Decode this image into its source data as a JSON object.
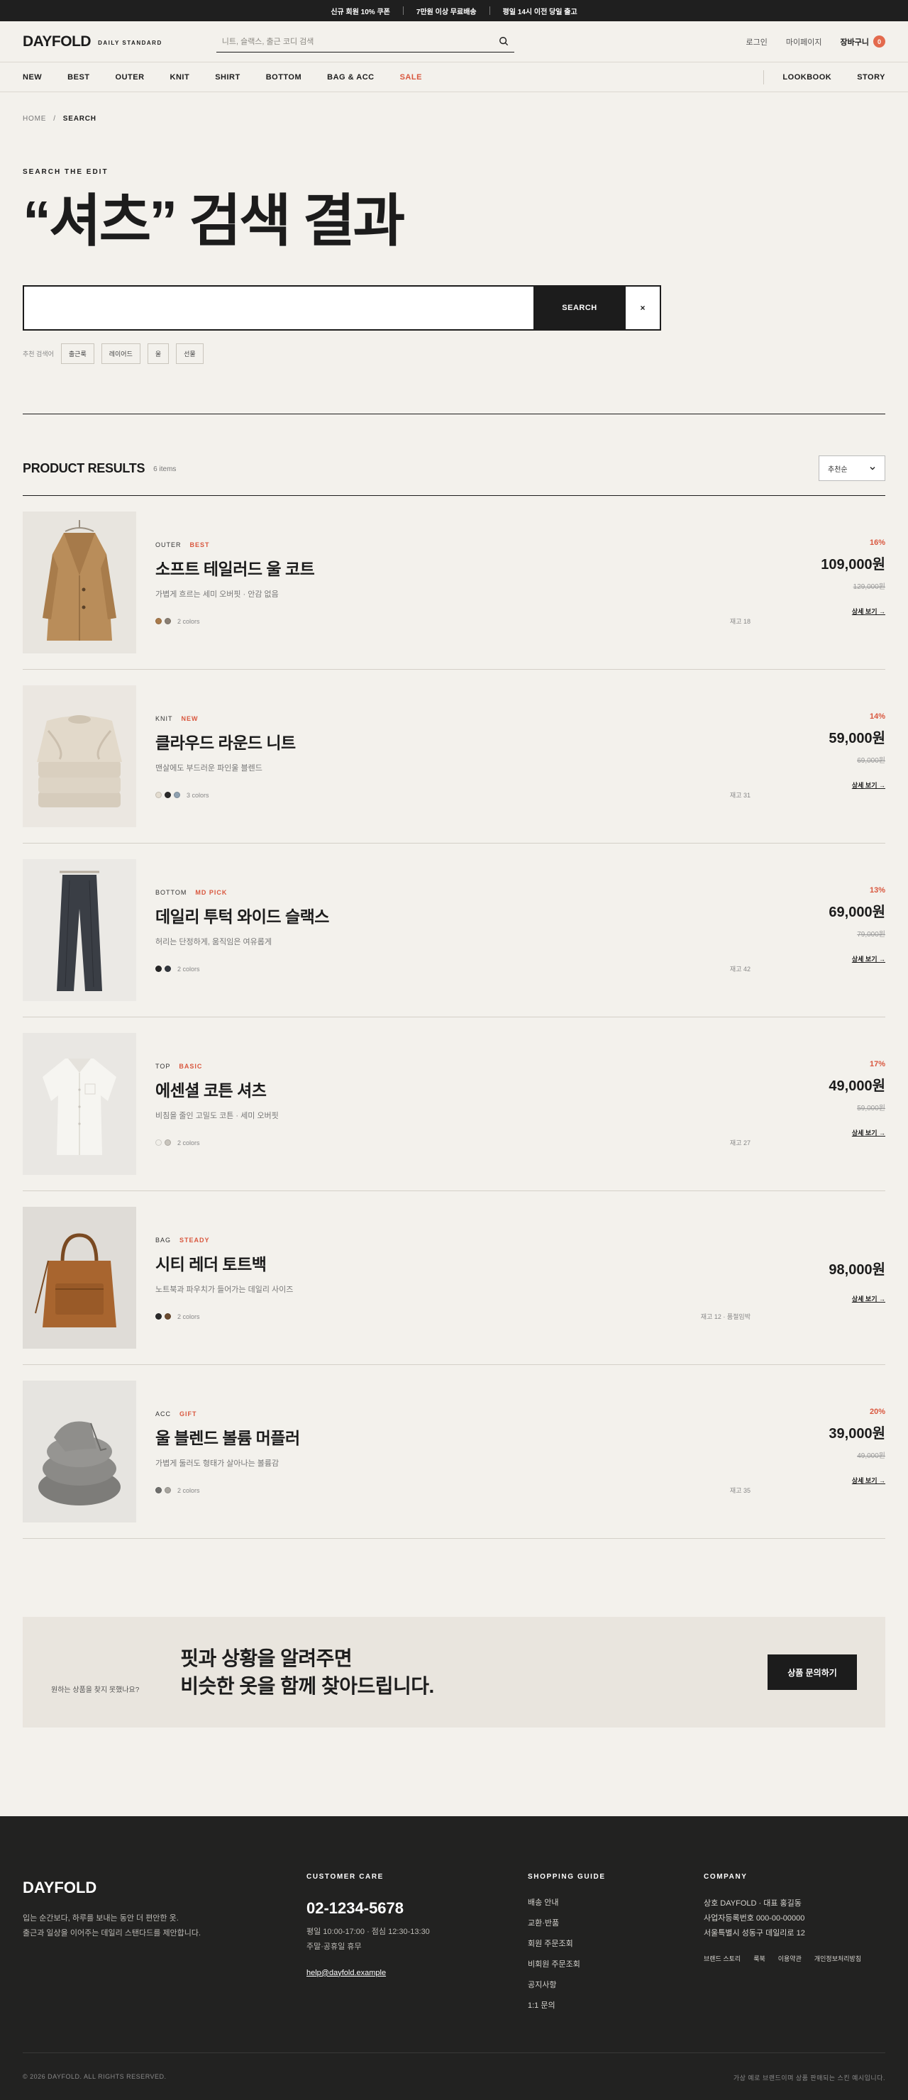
{
  "promo": [
    "신규 회원 10% 쿠폰",
    "7만원 이상 무료배송",
    "평일 14시 이전 당일 출고"
  ],
  "header": {
    "logo": "DAYFOLD",
    "logo_sub": "DAILY STANDARD",
    "search_placeholder": "니트, 슬랙스, 출근 코디 검색",
    "login": "로그인",
    "mypage": "마이페이지",
    "cart": "장바구니",
    "cart_count": "0"
  },
  "nav": {
    "left": [
      "NEW",
      "BEST",
      "OUTER",
      "KNIT",
      "SHIRT",
      "BOTTOM",
      "BAG & ACC",
      "SALE"
    ],
    "right": [
      "LOOKBOOK",
      "STORY"
    ]
  },
  "breadcrumb": {
    "home": "HOME",
    "sep": "/",
    "current": "SEARCH"
  },
  "eyebrow": "SEARCH THE EDIT",
  "title": "“셔츠” 검색 결과",
  "search_form": {
    "value": "",
    "button": "SEARCH",
    "clear": "×"
  },
  "keywords": {
    "label": "추천 검색어",
    "items": [
      "출근룩",
      "레이어드",
      "울",
      "선물"
    ]
  },
  "results": {
    "title": "PRODUCT RESULTS",
    "count": "6 items",
    "sort": "추천순"
  },
  "products": [
    {
      "category": "OUTER",
      "badge": "BEST",
      "name": "소프트 테일러드 울 코트",
      "desc": "가볍게 흐르는 세미 오버핏 · 안감 없음",
      "swatches": [
        "#a97a4a",
        "#8a7f73"
      ],
      "colors": "2 colors",
      "stock": "재고 18",
      "discount": "16%",
      "price": "109,000원",
      "original": "129,000원",
      "link": "상세 보기 →"
    },
    {
      "category": "KNIT",
      "badge": "NEW",
      "name": "클라우드 라운드 니트",
      "desc": "맨살에도 부드러운 파인울 블렌드",
      "swatches": [
        "#e4ddd0",
        "#2a2a2a",
        "#8fa1b0"
      ],
      "colors": "3 colors",
      "stock": "재고 31",
      "discount": "14%",
      "price": "59,000원",
      "original": "69,000원",
      "link": "상세 보기 →"
    },
    {
      "category": "BOTTOM",
      "badge": "MD PICK",
      "name": "데일리 투턱 와이드 슬랙스",
      "desc": "허리는 단정하게, 움직임은 여유롭게",
      "swatches": [
        "#262626",
        "#33383f"
      ],
      "colors": "2 colors",
      "stock": "재고 42",
      "discount": "13%",
      "price": "69,000원",
      "original": "79,000원",
      "link": "상세 보기 →"
    },
    {
      "category": "TOP",
      "badge": "BASIC",
      "name": "에센셜 코튼 셔츠",
      "desc": "비침을 줄인 고밀도 코튼 · 세미 오버핏",
      "swatches": [
        "#f1efe9",
        "#c9c5bd"
      ],
      "colors": "2 colors",
      "stock": "재고 27",
      "discount": "17%",
      "price": "49,000원",
      "original": "59,000원",
      "link": "상세 보기 →"
    },
    {
      "category": "BAG",
      "badge": "STEADY",
      "name": "시티 레더 토트백",
      "desc": "노트북과 파우치가 들어가는 데일리 사이즈",
      "swatches": [
        "#2a2a2a",
        "#6b4b30"
      ],
      "colors": "2 colors",
      "stock": "재고 12 · 품절임박",
      "discount": "",
      "price": "98,000원",
      "original": "",
      "link": "상세 보기 →"
    },
    {
      "category": "ACC",
      "badge": "GIFT",
      "name": "울 블렌드 볼륨 머플러",
      "desc": "가볍게 둘러도 형태가 살아나는 볼륨감",
      "swatches": [
        "#6f6f6d",
        "#a8a59f"
      ],
      "colors": "2 colors",
      "stock": "재고 35",
      "discount": "20%",
      "price": "39,000원",
      "original": "49,000원",
      "link": "상세 보기 →"
    }
  ],
  "banner": {
    "small": "원하는 상품을 찾지 못했나요?",
    "line1": "핏과 상황을 알려주면",
    "line2": "비슷한 옷을 함께 찾아드립니다.",
    "button": "상품 문의하기"
  },
  "footer": {
    "logo": "DAYFOLD",
    "tag1": "입는 순간보다, 하루를 보내는 동안 더 편안한 옷.",
    "tag2": "출근과 일상을 이어주는 데일리 스탠다드를 제안합니다.",
    "care_title": "CUSTOMER CARE",
    "phone": "02-1234-5678",
    "hours1": "평일 10:00-17:00 · 점심 12:30-13:30",
    "hours2": "주말·공휴일 휴무",
    "email": "help@dayfold.example",
    "guide_title": "SHOPPING GUIDE",
    "guide": [
      "배송 안내",
      "교환·반품",
      "회원 주문조회",
      "비회원 주문조회",
      "공지사항",
      "1:1 문의"
    ],
    "company_title": "COMPANY",
    "company1": "상호 DAYFOLD · 대표 홍길동",
    "company2": "사업자등록번호 000-00-00000",
    "company3": "서울특별시 성동구 데일리로 12",
    "links": [
      "브랜드 스토리",
      "룩북",
      "이용약관",
      "개인정보처리방침"
    ],
    "copyright": "© 2026 DAYFOLD. ALL RIGHTS RESERVED.",
    "notice": "가상 예로 브랜드이며 상품 판매되는 스킨 예시입니다."
  },
  "colors": {
    "accent": "#d9573e",
    "dark": "#1c1c1c",
    "bg": "#f3f1ec",
    "footer": "#222221"
  },
  "icons": [
    "search-icon",
    "chevron-down-icon"
  ]
}
